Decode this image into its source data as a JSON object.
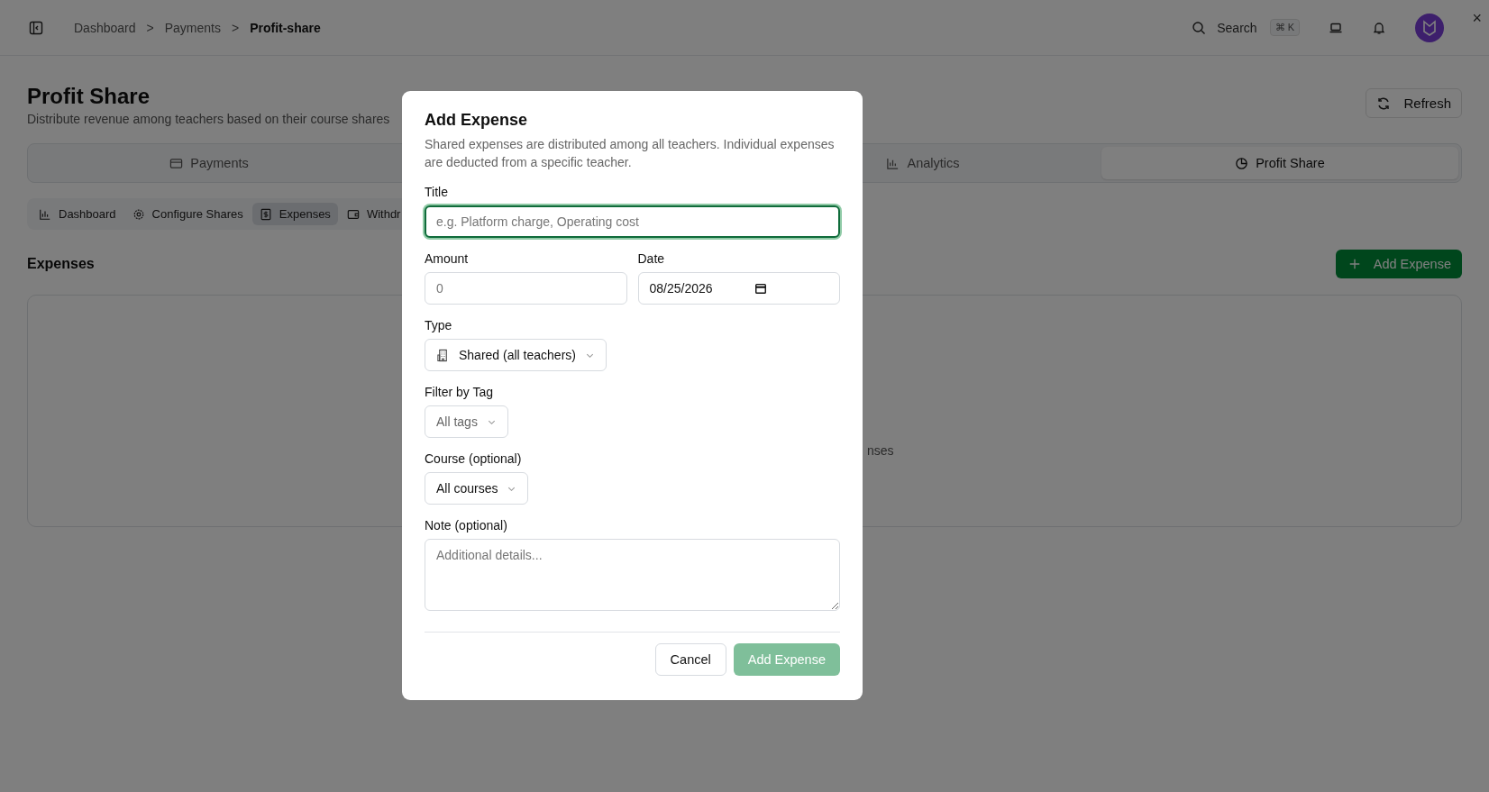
{
  "header": {
    "breadcrumbs": [
      {
        "label": "Dashboard",
        "current": false
      },
      {
        "label": "Payments",
        "current": false
      },
      {
        "label": "Profit-share",
        "current": true
      }
    ],
    "separator": ">",
    "search": {
      "label": "Search",
      "shortcut": "⌘ K"
    },
    "close_glyph": "×"
  },
  "page": {
    "title": "Profit Share",
    "subtitle": "Distribute revenue among teachers based on their course shares",
    "refresh": "Refresh",
    "tabs": [
      {
        "label": "Payments",
        "selected": false
      },
      {
        "label": "Analytics",
        "selected": false
      },
      {
        "label": "Profit Share",
        "selected": true
      }
    ],
    "subtabs": [
      {
        "label": "Dashboard",
        "selected": false
      },
      {
        "label": "Configure Shares",
        "selected": false
      },
      {
        "label": "Expenses",
        "selected": true
      },
      {
        "label": "Withdr",
        "selected": false
      }
    ],
    "section_title": "Expenses",
    "add_button": "Add Expense",
    "empty_text": "nses"
  },
  "modal": {
    "title": "Add Expense",
    "description": "Shared expenses are distributed among all teachers. Individual expenses are deducted from a specific teacher.",
    "title_field": {
      "label": "Title",
      "placeholder": "e.g. Platform charge, Operating cost",
      "focused": true
    },
    "amount_field": {
      "label": "Amount",
      "placeholder": "0"
    },
    "date_field": {
      "label": "Date",
      "value": "08/25/2026"
    },
    "type_select": {
      "label": "Type",
      "value": "Shared (all teachers)"
    },
    "tag_select": {
      "label": "Filter by Tag",
      "placeholder": "All tags"
    },
    "course_select": {
      "label": "Course (optional)",
      "value": "All courses"
    },
    "note_field": {
      "label": "Note (optional)",
      "placeholder": "Additional details..."
    },
    "cancel": "Cancel",
    "submit": {
      "label": "Add Expense",
      "disabled": true
    }
  }
}
